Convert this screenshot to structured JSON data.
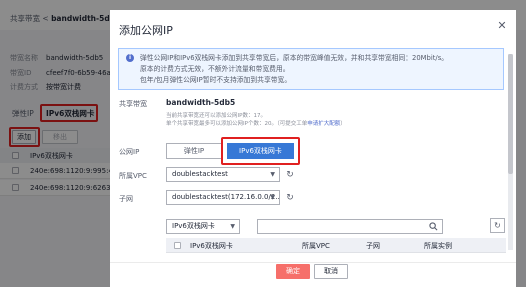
{
  "background": {
    "breadcrumb_parent": "共享带宽",
    "breadcrumb_sep": " < ",
    "breadcrumb_current": "bandwidth-5db5",
    "info": [
      {
        "key": "带宽名称",
        "value": "bandwidth-5db5"
      },
      {
        "key": "带宽ID",
        "value": "cfeef7f0-6b59-46a"
      },
      {
        "key": "计费方式",
        "value": "按带宽计费"
      }
    ],
    "tab_eip": "弹性IP",
    "tab_ipv6": "IPv6双栈网卡",
    "add_button": "添加",
    "remove_button": "移出",
    "table_header": "IPv6双栈网卡",
    "rows": [
      "240e:698:1120:9:995:44",
      "240e:698:1120:9:6263:a"
    ]
  },
  "modal": {
    "title": "添加公网IP",
    "notice": [
      "弹性公网IP和IPv6双栈网卡添加到共享带宽后，原本的带宽峰值无效，并和共享带宽相同：20Mbit/s。",
      "原本的计费方式无效，不额外计流量和带宽费用。",
      "包年/包月弹性公网IP暂时不支持添加到共享带宽。"
    ],
    "shared_bandwidth_label": "共享带宽",
    "shared_bandwidth_value": "bandwidth-5db5",
    "hint_line1": "当前共享带宽还可以添加公网IP数：17。",
    "hint_line2_prefix": "单个共享带宽最多可以添加公网IP个数：20。（可提交工单",
    "hint_link": "申请扩大配额",
    "hint_line2_suffix": "）",
    "public_ip_label": "公网IP",
    "seg_eip": "弹性IP",
    "seg_ipv6": "IPv6双栈网卡",
    "vpc_label": "所属VPC",
    "vpc_value": "doublestacktest",
    "subnet_label": "子网",
    "subnet_value": "doublestacktest(172.16.0.0/2...",
    "filter_value": "IPv6双栈网卡",
    "columns": [
      "IPv6双栈网卡",
      "所属VPC",
      "子网",
      "所属实例"
    ],
    "confirm": "确定",
    "cancel": "取消"
  },
  "colors": {
    "primary": "#3778d6",
    "confirm": "#f66f6a",
    "highlight": "#e02020"
  }
}
